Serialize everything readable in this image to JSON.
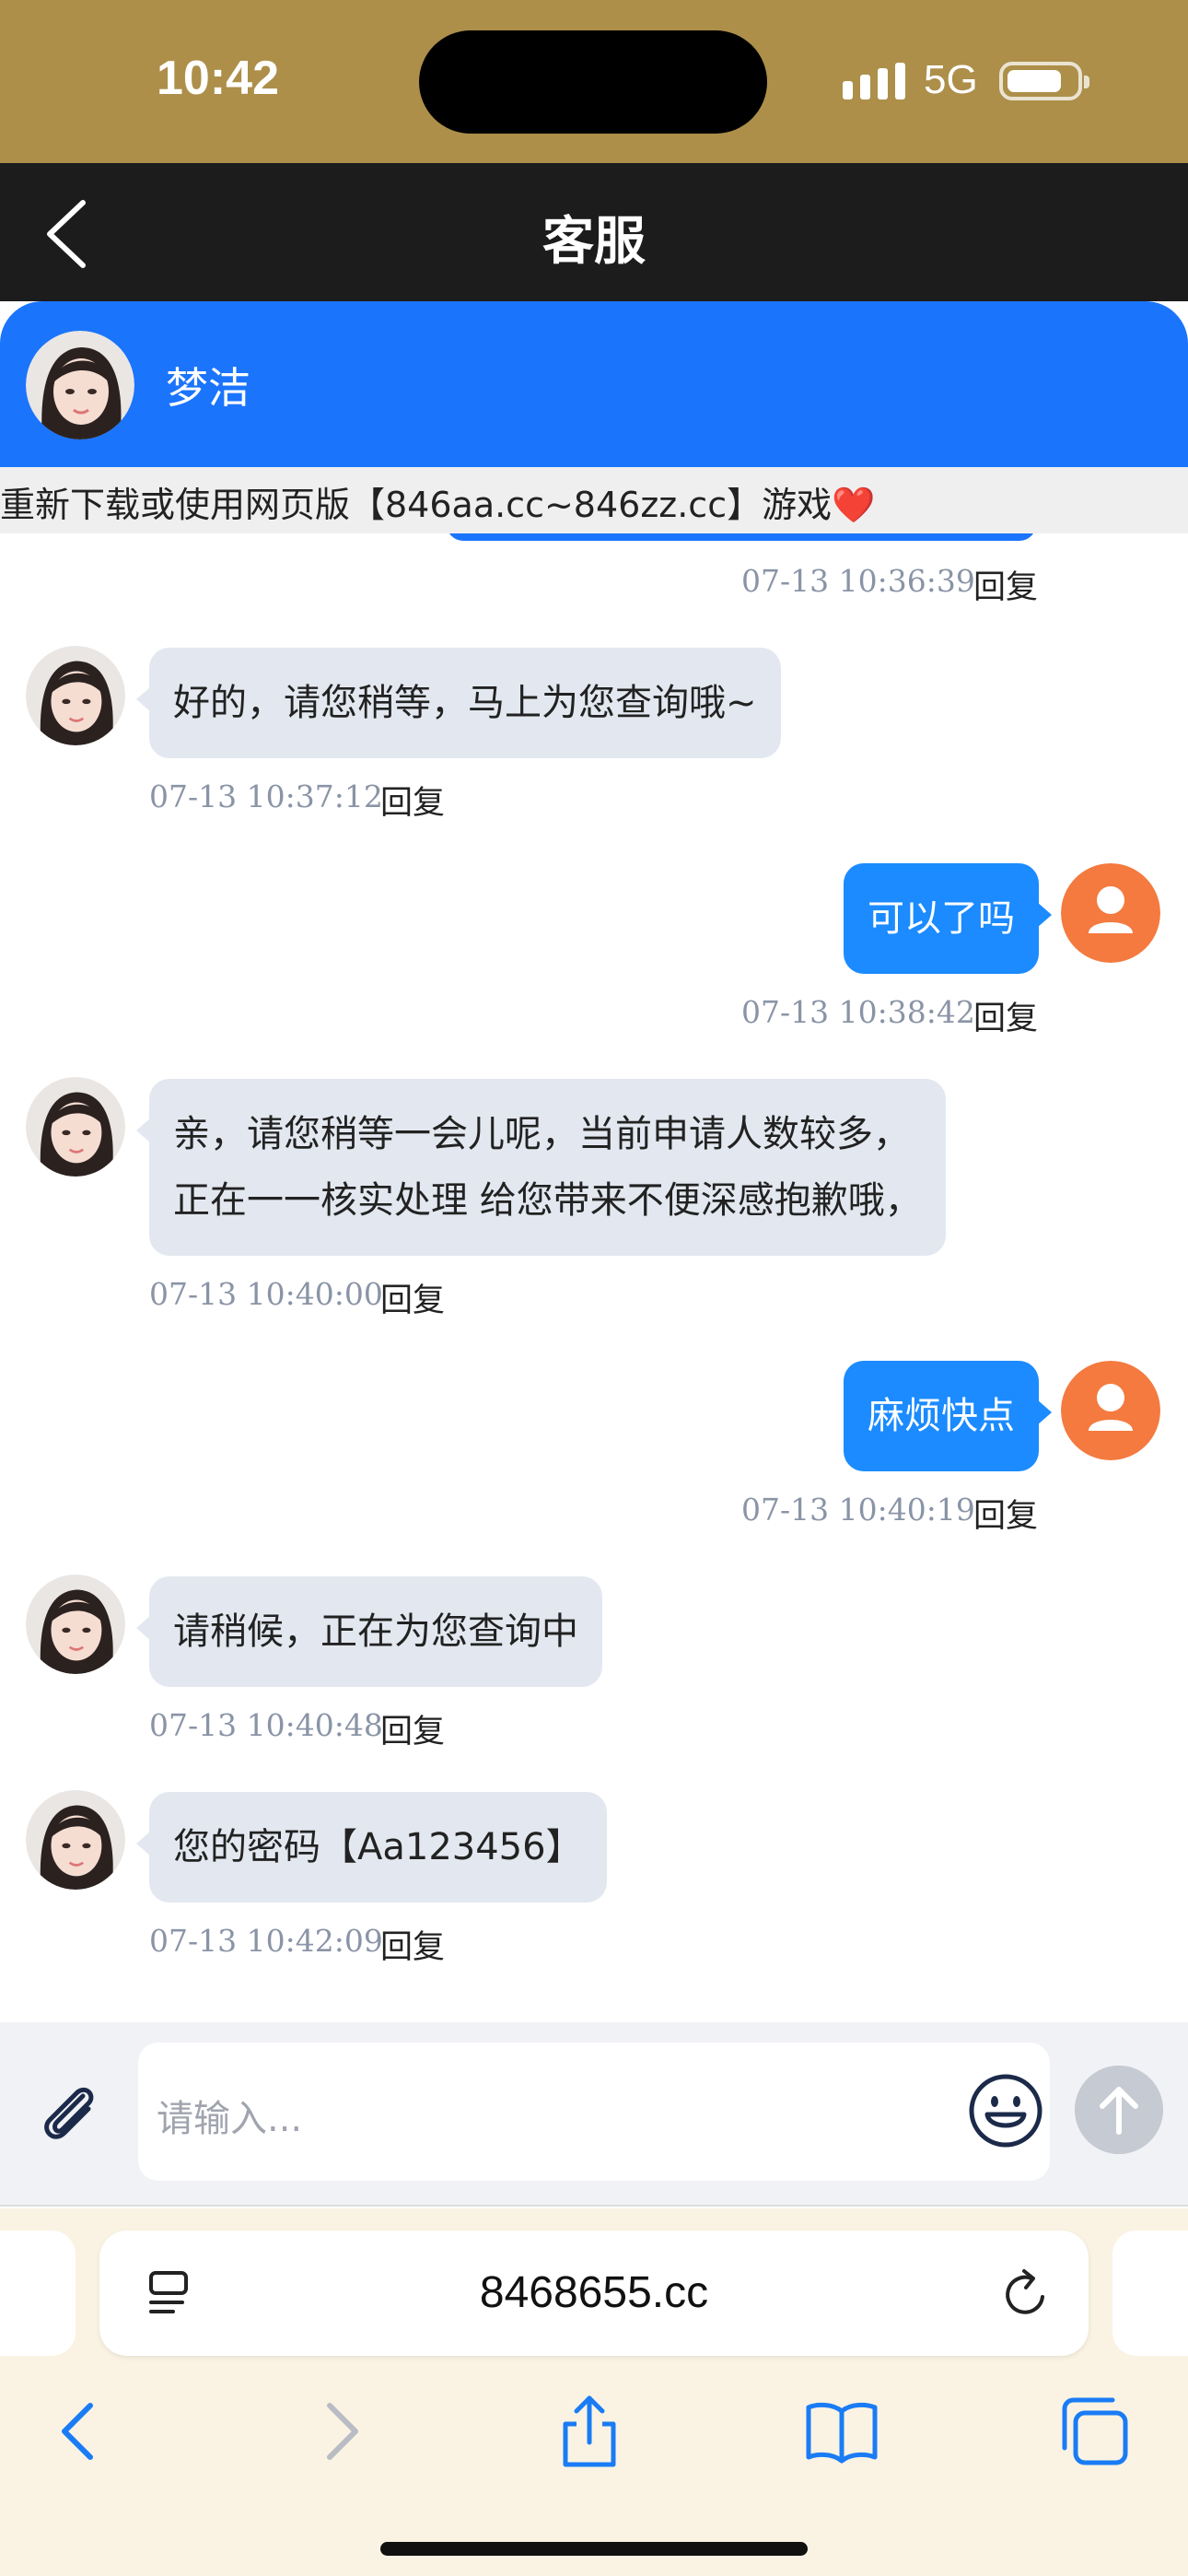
{
  "status": {
    "time": "10:42",
    "network": "5G"
  },
  "nav": {
    "title": "客服"
  },
  "agent": {
    "name": "梦洁"
  },
  "notice": {
    "text": "重新下载或使用网页版【846aa.cc~846zz.cc】游戏❤️"
  },
  "reply_label": "回复",
  "messages": [
    {
      "id": "m0",
      "time": "07-13 10:36:39"
    },
    {
      "id": "m1",
      "text": "好的，请您稍等，马上为您查询哦~",
      "time": "07-13 10:37:12"
    },
    {
      "id": "m2",
      "text": "可以了吗",
      "time": "07-13 10:38:42"
    },
    {
      "id": "m3",
      "lines": [
        "亲，请您稍等一会儿呢，当前申请人数较多，",
        "正在一一核实处理 给您带来不便深感抱歉哦，"
      ],
      "time": "07-13 10:40:00"
    },
    {
      "id": "m4",
      "text": "麻烦快点",
      "time": "07-13 10:40:19"
    },
    {
      "id": "m5",
      "text": "请稍候，正在为您查询中",
      "time": "07-13 10:40:48"
    },
    {
      "id": "m6",
      "text": "您的密码【Aa123456】",
      "time": "07-13 10:42:09"
    }
  ],
  "input": {
    "placeholder": "请输入..."
  },
  "browser": {
    "url": "8468655.cc"
  },
  "icons": {
    "back": "chevron-left-icon",
    "attach": "paperclip-icon",
    "emoji": "smiley-icon",
    "send": "arrow-up-icon",
    "reader": "reader-icon",
    "reload": "reload-icon",
    "toolbar": [
      "back-icon",
      "forward-icon",
      "share-icon",
      "bookmarks-icon",
      "tabs-icon"
    ]
  },
  "colors": {
    "accent": "#1b74fc",
    "user_bubble": "#1b8bff",
    "agent_bubble": "#e3e8f0",
    "user_avatar": "#f47a3f",
    "statusbar": "#ad8f4a"
  }
}
